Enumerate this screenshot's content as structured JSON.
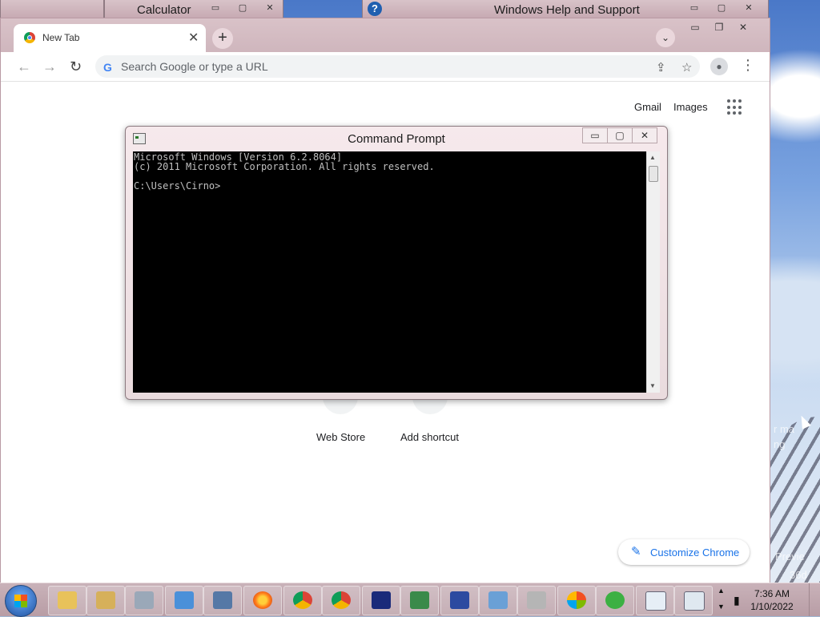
{
  "background_windows": {
    "calculator_title": "Calculator",
    "help_title": "Windows Help and Support",
    "help_icon": "?"
  },
  "chrome": {
    "tab_title": "New Tab",
    "tab_close": "✕",
    "new_tab": "+",
    "tab_search": "⌄",
    "omnibox_placeholder": "Search Google or type a URL",
    "google_g": "G",
    "links": {
      "gmail": "Gmail",
      "images": "Images"
    },
    "shortcuts": [
      {
        "label": "Web Store"
      },
      {
        "label": "Add shortcut"
      }
    ],
    "customize_label": "Customize Chrome",
    "window_controls": {
      "minimize": "▭",
      "maximize": "❐",
      "close": "✕"
    },
    "nav": {
      "back": "←",
      "forward": "→",
      "reload": "↻",
      "share": "⇪",
      "star": "☆",
      "menu": "⋮"
    }
  },
  "cmd": {
    "title": "Command Prompt",
    "lines": [
      "Microsoft Windows [Version 6.2.8064]",
      "(c) 2011 Microsoft Corporation. All rights reserved.",
      "",
      "C:\\Users\\Cirno>"
    ],
    "buttons": {
      "minimize": "▭",
      "maximize": "▢",
      "close": "✕"
    }
  },
  "taskbar": {
    "clock_time": "7:36 AM",
    "clock_date": "1/10/2022"
  },
  "desktop_text": {
    "line1": "r ma",
    "line2": "ng",
    "line3": "Previe",
    "line4": "36d"
  }
}
